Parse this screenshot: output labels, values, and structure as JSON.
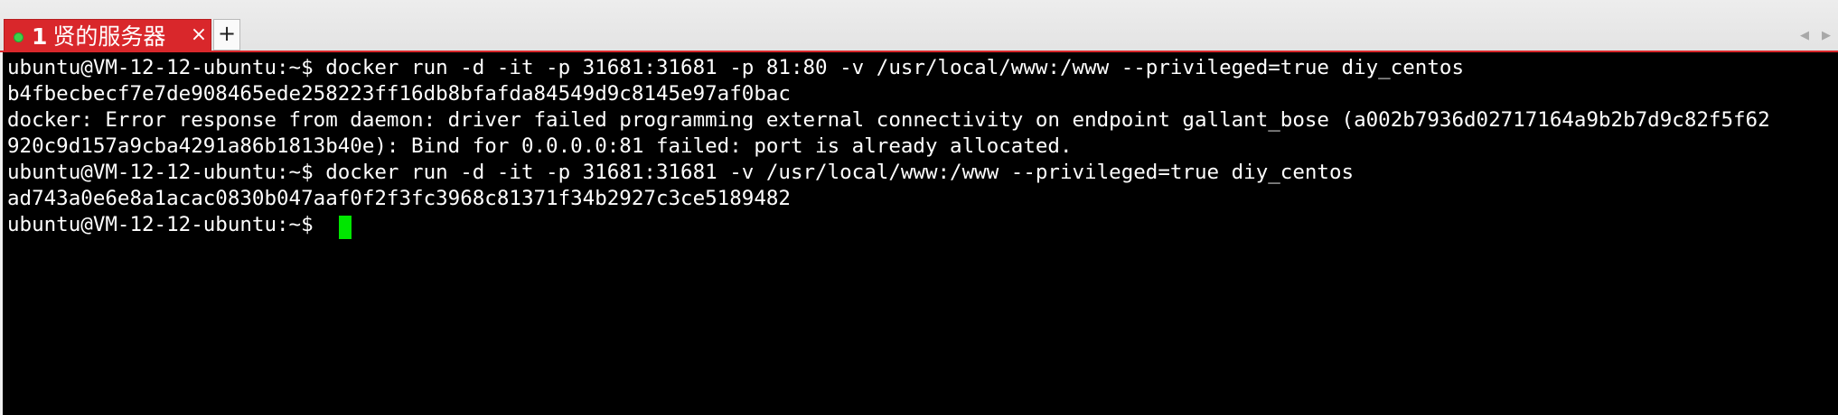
{
  "tabs": [
    {
      "number": "1",
      "title": "贤的服务器",
      "close_glyph": "×",
      "active": true,
      "status_color": "#3fd04a"
    }
  ],
  "new_tab_label": "+",
  "tab_scroll": {
    "left_glyph": "◀",
    "right_glyph": "▶"
  },
  "colors": {
    "accent": "#d9272b",
    "terminal_bg": "#000000",
    "terminal_fg": "#ffffff",
    "cursor": "#00e600"
  },
  "terminal": {
    "lines": [
      "ubuntu@VM-12-12-ubuntu:~$ docker run -d -it -p 31681:31681 -p 81:80 -v /usr/local/www:/www --privileged=true diy_centos",
      "b4fbecbecf7e7de908465ede258223ff16db8bfafda84549d9c8145e97af0bac",
      "docker: Error response from daemon: driver failed programming external connectivity on endpoint gallant_bose (a002b7936d02717164a9b2b7d9c82f5f62",
      "920c9d157a9cba4291a86b1813b40e): Bind for 0.0.0.0:81 failed: port is already allocated.",
      "ubuntu@VM-12-12-ubuntu:~$ docker run -d -it -p 31681:31681 -v /usr/local/www:/www --privileged=true diy_centos",
      "ad743a0e6e8a1acac0830b047aaf0f2f3fc3968c81371f34b2927c3ce5189482",
      "ubuntu@VM-12-12-ubuntu:~$ "
    ]
  }
}
